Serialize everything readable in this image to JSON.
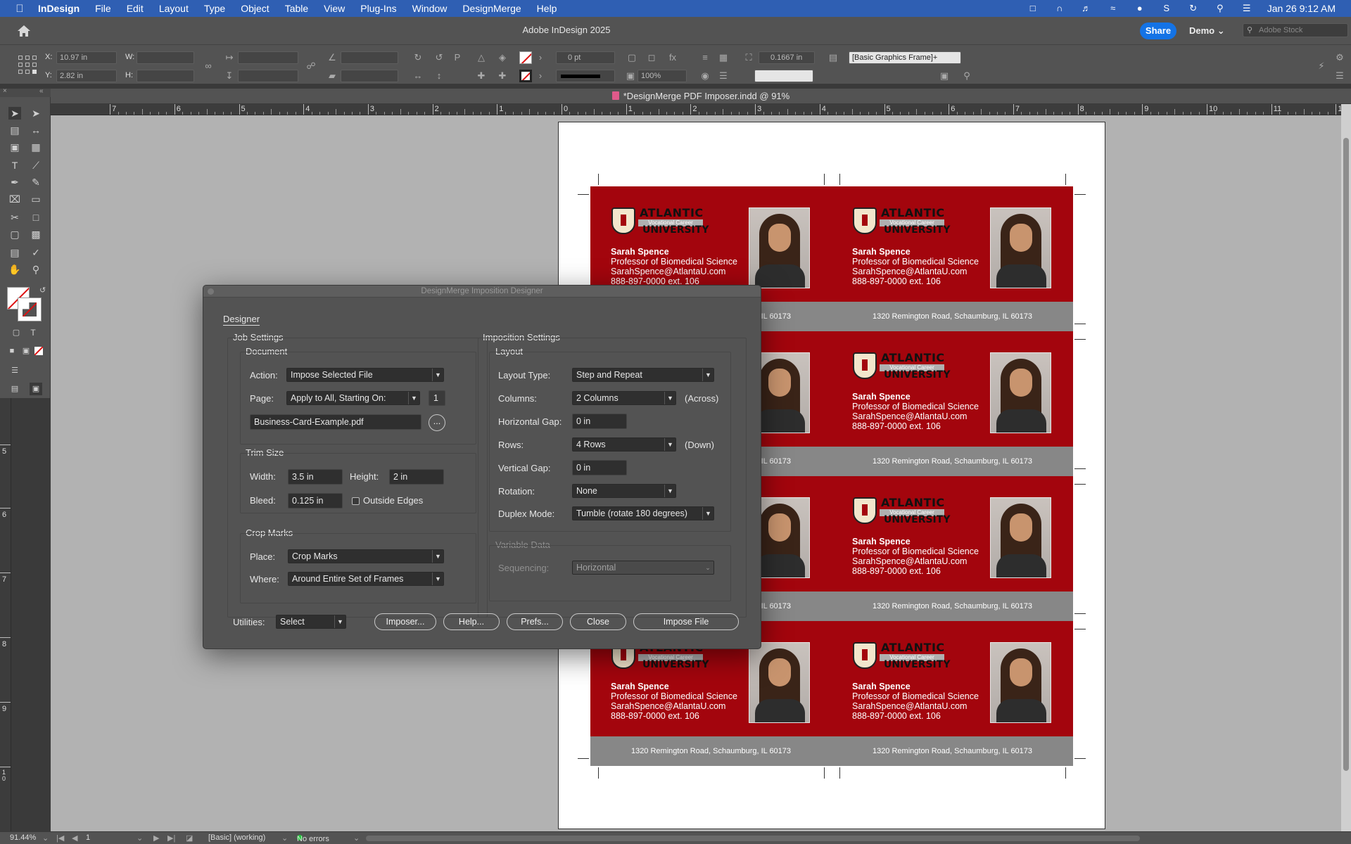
{
  "menubar": {
    "items": [
      "InDesign",
      "File",
      "Edit",
      "Layout",
      "Type",
      "Object",
      "Table",
      "View",
      "Plug-Ins",
      "Window",
      "DesignMerge",
      "Help"
    ],
    "datetime": "Jan 26  9:12 AM"
  },
  "titlebar": {
    "title": "Adobe InDesign 2025",
    "share": "Share",
    "workspace": "Demo",
    "stock_placeholder": "Adobe Stock"
  },
  "control": {
    "x_label": "X:",
    "x_value": "10.97 in",
    "y_label": "Y:",
    "y_value": "2.82 in",
    "w_label": "W:",
    "h_label": "H:",
    "stroke_weight": "0 pt",
    "opacity": "100%",
    "offset": "0.1667 in",
    "object_style": "[Basic Graphics Frame]+"
  },
  "document": {
    "tab_title": "*DesignMerge PDF Imposer.indd @ 91%"
  },
  "ruler": {
    "h_numbers": [
      "7",
      "6",
      "5",
      "4",
      "3",
      "2",
      "1",
      "0",
      "1",
      "2",
      "3",
      "4",
      "5",
      "6",
      "7",
      "8",
      "9",
      "10",
      "11",
      "12"
    ],
    "v_numbers": [
      "5",
      "6",
      "7",
      "8",
      "9",
      "10"
    ]
  },
  "card": {
    "logo_top": "ATLANTIC",
    "logo_band": "Vocational Career",
    "logo_bottom": "UNIVERSITY",
    "name": "Sarah Spence",
    "title": "Professor of Biomedical Science",
    "email": "SarahSpence@AtlantaU.com",
    "phone": "888-897-0000 ext. 106",
    "address": "1320 Remington Road, Schaumburg, IL 60173",
    "address_partial": "IL 60173"
  },
  "dialog": {
    "title": "DesignMerge Imposition Designer",
    "tab": "Designer",
    "job_settings": "Job Settings",
    "document_group": "Document",
    "action_label": "Action:",
    "action_value": "Impose Selected File",
    "page_label": "Page:",
    "page_value": "Apply to All, Starting On:",
    "page_number": "1",
    "file_value": "Business-Card-Example.pdf",
    "browse": "...",
    "trim_group": "Trim Size",
    "width_label": "Width:",
    "width_value": "3.5 in",
    "height_label": "Height:",
    "height_value": "2 in",
    "bleed_label": "Bleed:",
    "bleed_value": "0.125 in",
    "outside_edges": "Outside Edges",
    "crop_group": "Crop Marks",
    "place_label": "Place:",
    "place_value": "Crop Marks",
    "where_label": "Where:",
    "where_value": "Around Entire Set of Frames",
    "imposition_settings": "Imposition Settings",
    "layout_group": "Layout",
    "layout_type_label": "Layout Type:",
    "layout_type_value": "Step and Repeat",
    "columns_label": "Columns:",
    "columns_value": "2 Columns",
    "columns_suffix": "(Across)",
    "hgap_label": "Horizontal Gap:",
    "hgap_value": "0 in",
    "rows_label": "Rows:",
    "rows_value": "4 Rows",
    "rows_suffix": "(Down)",
    "vgap_label": "Vertical Gap:",
    "vgap_value": "0 in",
    "rotation_label": "Rotation:",
    "rotation_value": "None",
    "duplex_label": "Duplex Mode:",
    "duplex_value": "Tumble (rotate 180 degrees)",
    "variable_group": "Variable Data",
    "sequencing_label": "Sequencing:",
    "sequencing_value": "Horizontal",
    "utilities_label": "Utilities:",
    "utilities_value": "Select",
    "btn_imposer": "Imposer...",
    "btn_help": "Help...",
    "btn_prefs": "Prefs...",
    "btn_close": "Close",
    "btn_impose": "Impose File"
  },
  "status": {
    "zoom": "91.44%",
    "page": "1",
    "style": "[Basic] (working)",
    "errors": "No errors"
  }
}
